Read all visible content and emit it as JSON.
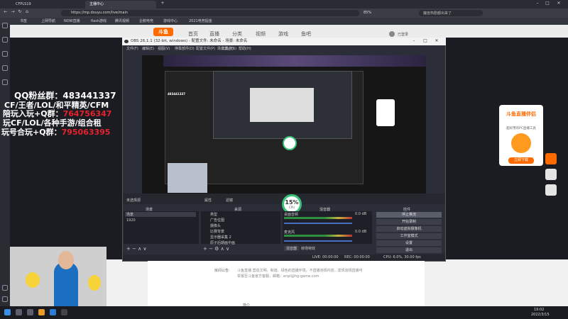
{
  "browser": {
    "tabs": [
      {
        "label": "CFPLS19"
      },
      {
        "label": "主播中心"
      }
    ],
    "url": "https://mp.douyu.com/live/main",
    "zoom": "85%",
    "search_hint": "魔兽热剧都出来了",
    "bookmarks": [
      "书签",
      "上网导航",
      "NOW直播",
      "flash游戏",
      "腾讯视频",
      "企鹅电竞",
      "游戏中心",
      "2021电竞掘金"
    ],
    "user_label": "已登录"
  },
  "douyu": {
    "logo": "斗鱼",
    "nav": [
      "首页",
      "直播",
      "分类",
      "视频",
      "游戏",
      "鱼吧"
    ]
  },
  "overlay": {
    "line1_label": "QQ粉丝群：",
    "line1_value": "483441337",
    "line2": "CF/王者/LOL/和平精英/CFM",
    "line3_label": "陪玩入玩+Q群：",
    "line3_value": "764756347",
    "line4": "玩CF/LOL/各种手游/组合租",
    "line5_label": "玩号合玩+Q群：",
    "line5_value": "795063395"
  },
  "obs": {
    "title": "OBS 26.1.1 (32-bit, windows) - 配置文件: 未命名 - 场景: 未命名",
    "menu": [
      "文件(F)",
      "编辑(E)",
      "视图(V)",
      "停靠部件(D)",
      "配置文件(P)",
      "场景集合(S)",
      "工具(T)",
      "帮助(H)"
    ],
    "no_source": "未选择源",
    "properties": "属性",
    "filters": "滤镜",
    "docks": {
      "scenes_title": "场景",
      "sources_title": "来源",
      "mixer_title": "混音器",
      "controls_title": "控件"
    },
    "scenes": [
      "场景",
      "1920"
    ],
    "sources": [
      "类型",
      "广告位图",
      "摄像头",
      "比赛背景",
      "显示器采集 2",
      "原子后期画中画"
    ],
    "mixer": [
      {
        "name": "桌面音频",
        "db": "0.0 dB"
      },
      {
        "name": "麦克风",
        "db": "0.0 dB"
      }
    ],
    "mixer_tabs": [
      "混音器",
      "转场特效"
    ],
    "controls": [
      "停止推流",
      "开始录制",
      "启动虚拟摄像机",
      "工作室模式",
      "设置",
      "退出"
    ],
    "status": {
      "live": "LIVE: 00:00:00",
      "rec": "REC: 00:00:00",
      "cpu": "CPU: 6.0%, 30.00 fps"
    },
    "cpu_badge": "15%",
    "cpu_badge_sub": "CPU"
  },
  "page_info": {
    "label": "房间公告:",
    "text": "斗鱼直播 营造文明、和谐、绿色的直播环境，不直播违规内容，发现违规直播可举报至斗鱼官方客服，邮箱：enpl@hg-game.com",
    "bottom": "简介"
  },
  "ad": {
    "title": "斗鱼直播伴侣",
    "subtitle": "超好用的PC直播工具",
    "button": "立即下载"
  },
  "taskbar": {
    "time": "19:02",
    "date": "2022/3/15"
  },
  "colors": {
    "overlay_white": "#ffffff",
    "overlay_red": "#e8222d",
    "douyu_orange": "#ff6a00",
    "obs_bg": "#2b2e38",
    "stop_btn": "#5a5e6b"
  }
}
